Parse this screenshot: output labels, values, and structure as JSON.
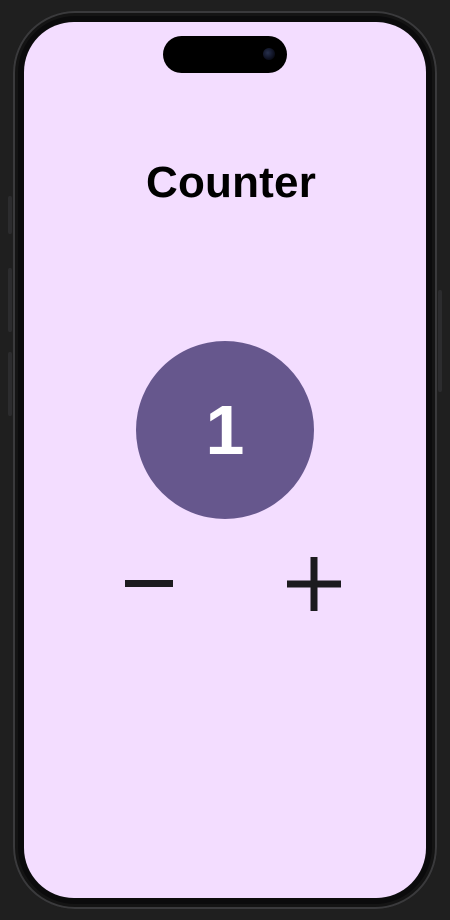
{
  "app": {
    "title": "Counter"
  },
  "counter": {
    "value": "1",
    "decrement_icon": "minus-icon",
    "increment_icon": "plus-icon"
  },
  "colors": {
    "screen_background": "#f3ddff",
    "counter_circle": "#66578d",
    "counter_text": "#ffffff",
    "title_text": "#000000",
    "control_icon": "#1c1b1f"
  }
}
